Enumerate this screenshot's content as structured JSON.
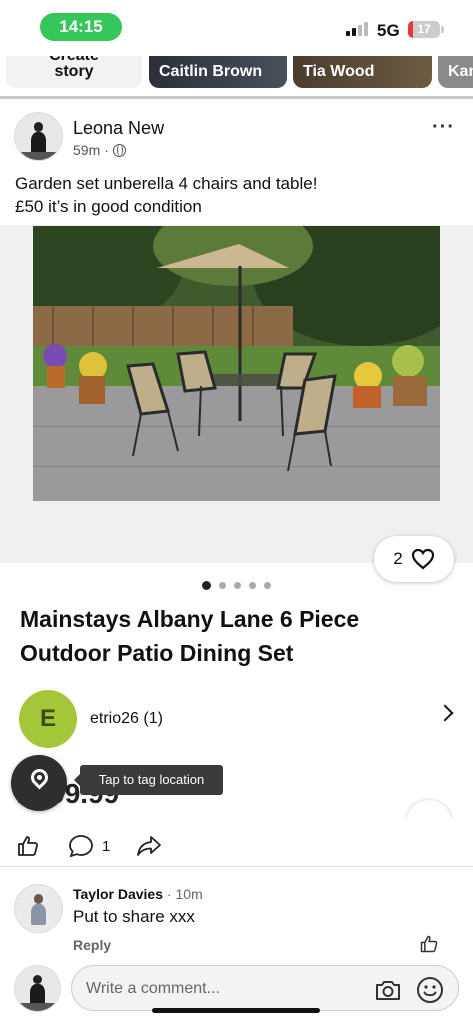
{
  "status_bar": {
    "time": "14:15",
    "network": "5G",
    "battery": "17",
    "battery_level": 0.17
  },
  "stories": {
    "create_top": "Create",
    "create_label": "story",
    "items": [
      {
        "name": "Caitlin Brown"
      },
      {
        "name": "Tia Wood"
      },
      {
        "name": "Kan"
      }
    ]
  },
  "post": {
    "author": "Leona New",
    "time": "59m",
    "text_line1": "Garden set unberella 4 chairs and table!",
    "text_line2": "£50 it’s in good condition",
    "like_count": "2"
  },
  "listing": {
    "title": "Mainstays Albany Lane 6 Piece Outdoor Patio Dining Set",
    "seller_initial": "E",
    "seller_name": "etrio26 (1)",
    "price": "£199.99",
    "tooltip": "Tap to tag location",
    "carousel": {
      "count": 5,
      "active": 0
    }
  },
  "actions": {
    "comment_count": "1"
  },
  "comment": {
    "author": "Taylor Davies",
    "time": "10m",
    "text": "Put to share xxx",
    "reply_label": "Reply"
  },
  "composer": {
    "placeholder": "Write a comment..."
  },
  "colors": {
    "status_pill": "#35c759",
    "seller_avatar": "#a4c639",
    "battery_red": "#e5383b"
  }
}
